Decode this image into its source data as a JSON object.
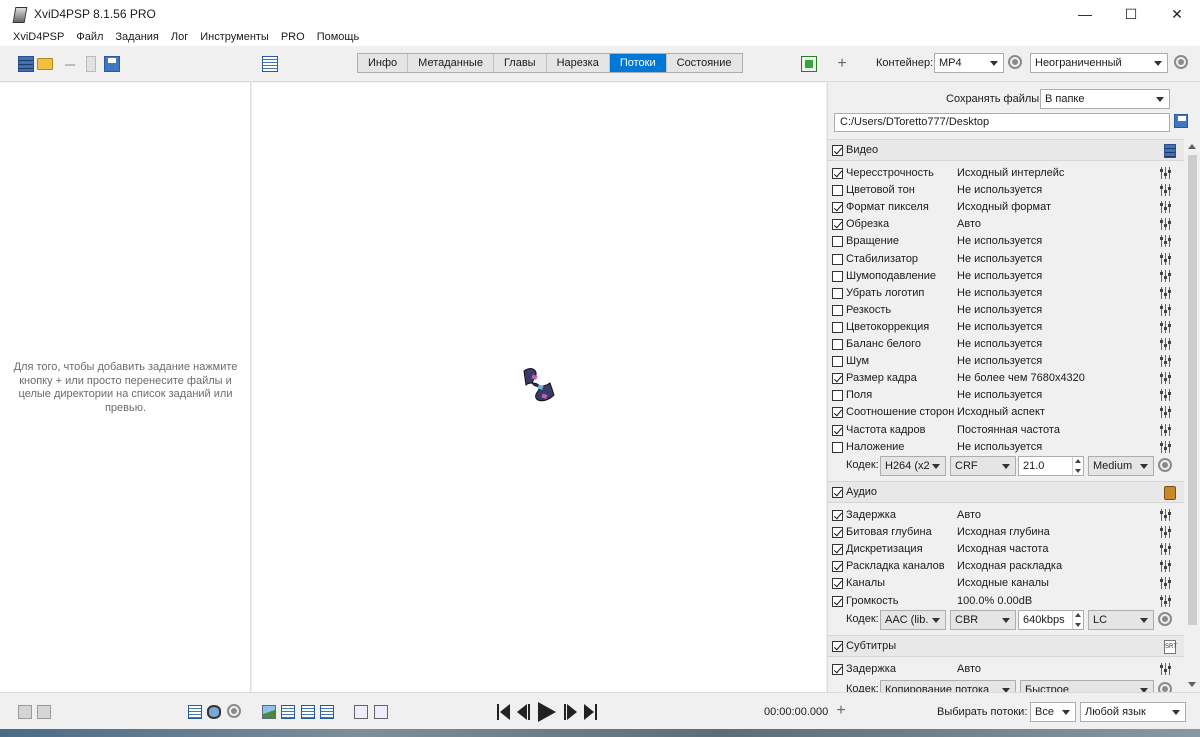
{
  "window": {
    "title": "XviD4PSP 8.1.56 PRO",
    "controls": {
      "minimize": "—",
      "maximize": "☐",
      "close": "✕"
    }
  },
  "menu": [
    "XviD4PSP",
    "Файл",
    "Задания",
    "Лог",
    "Инструменты",
    "PRO",
    "Помощь"
  ],
  "tabs": [
    "Инфо",
    "Метаданные",
    "Главы",
    "Нарезка",
    "Потоки",
    "Состояние"
  ],
  "active_tab": "Потоки",
  "toolbar": {
    "container_label": "Контейнер:",
    "container_value": "MP4",
    "limit_value": "Неограниченный"
  },
  "left_panel": {
    "hint": "Для того, чтобы добавить задание нажмите кнопку + или просто перенесите файлы и целые директории на список заданий или превью."
  },
  "output": {
    "save_label": "Сохранять файлы:",
    "save_mode": "В папке",
    "path": "C:/Users/DToretto777/Desktop"
  },
  "video": {
    "title": "Видео",
    "enabled": true,
    "filters": [
      {
        "name": "Чересстрочность",
        "value": "Исходный интерлейс",
        "on": true
      },
      {
        "name": "Цветовой тон",
        "value": "Не используется",
        "on": false
      },
      {
        "name": "Формат пикселя",
        "value": "Исходный формат",
        "on": true
      },
      {
        "name": "Обрезка",
        "value": "Авто",
        "on": true
      },
      {
        "name": "Вращение",
        "value": "Не используется",
        "on": false
      },
      {
        "name": "Стабилизатор",
        "value": "Не используется",
        "on": false
      },
      {
        "name": "Шумоподавление",
        "value": "Не используется",
        "on": false
      },
      {
        "name": "Убрать логотип",
        "value": "Не используется",
        "on": false
      },
      {
        "name": "Резкость",
        "value": "Не используется",
        "on": false
      },
      {
        "name": "Цветокоррекция",
        "value": "Не используется",
        "on": false
      },
      {
        "name": "Баланс белого",
        "value": "Не используется",
        "on": false
      },
      {
        "name": "Шум",
        "value": "Не используется",
        "on": false
      },
      {
        "name": "Размер кадра",
        "value": "Не более чем 7680x4320",
        "on": true
      },
      {
        "name": "Поля",
        "value": "Не используется",
        "on": false
      },
      {
        "name": "Соотношение сторон",
        "value": "Исходный аспект",
        "on": true
      },
      {
        "name": "Частота кадров",
        "value": "Постоянная частота",
        "on": true
      },
      {
        "name": "Наложение",
        "value": "Не используется",
        "on": false
      }
    ],
    "codec_label": "Кодек:",
    "codec": "H264 (x2...",
    "mode": "CRF",
    "quality": "21.0",
    "preset": "Medium"
  },
  "audio": {
    "title": "Аудио",
    "enabled": true,
    "filters": [
      {
        "name": "Задержка",
        "value": "Авто",
        "on": true
      },
      {
        "name": "Битовая глубина",
        "value": "Исходная глубина",
        "on": true
      },
      {
        "name": "Дискретизация",
        "value": "Исходная частота",
        "on": true
      },
      {
        "name": "Раскладка каналов",
        "value": "Исходная раскладка",
        "on": true
      },
      {
        "name": "Каналы",
        "value": "Исходные каналы",
        "on": true
      },
      {
        "name": "Громкость",
        "value": "100.0% 0.00dB",
        "on": true
      }
    ],
    "codec_label": "Кодек:",
    "codec": "AAC (lib...",
    "mode": "CBR",
    "bitrate": "640kbps",
    "profile": "LC"
  },
  "subtitles": {
    "title": "Субтитры",
    "enabled": true,
    "filters": [
      {
        "name": "Задержка",
        "value": "Авто",
        "on": true
      }
    ],
    "codec_label": "Кодек:",
    "codec": "Копирование потока",
    "speed": "Быстрое"
  },
  "bottom": {
    "time": "00:00:00.000",
    "streams_label": "Выбирать потоки:",
    "streams_value": "Все",
    "language_value": "Любой язык"
  },
  "icons": {
    "plus": "+",
    "sub_badge": "SRT"
  }
}
